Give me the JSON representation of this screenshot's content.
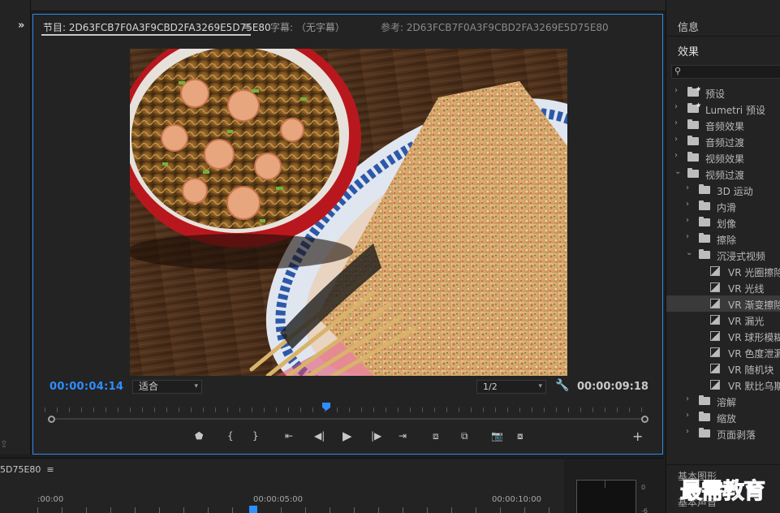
{
  "monitor": {
    "program_tab": "节目: 2D63FCB7F0A3F9CBD2FA3269E5D75E80",
    "menu_glyph": "≡",
    "caption_tab": "字幕: （无字幕）",
    "reference_tab": "参考: 2D63FCB7F0A3F9CBD2FA3269E5D75E80",
    "timecode_current": "00:00:04:14",
    "timecode_duration": "00:00:09:18",
    "fit_option": "适合",
    "resolution_option": "1/2",
    "playhead_fraction": 0.45
  },
  "right_panel": {
    "info_tab": "信息",
    "effects_tab": "效果",
    "tree": [
      {
        "label": "预设",
        "indent": 0,
        "expanded": false,
        "kind": "folder-star"
      },
      {
        "label": "Lumetri 预设",
        "indent": 0,
        "expanded": false,
        "kind": "folder-star"
      },
      {
        "label": "音频效果",
        "indent": 0,
        "expanded": false,
        "kind": "folder"
      },
      {
        "label": "音频过渡",
        "indent": 0,
        "expanded": false,
        "kind": "folder"
      },
      {
        "label": "视频效果",
        "indent": 0,
        "expanded": false,
        "kind": "folder"
      },
      {
        "label": "视频过渡",
        "indent": 0,
        "expanded": true,
        "kind": "folder"
      },
      {
        "label": "3D 运动",
        "indent": 1,
        "expanded": false,
        "kind": "folder"
      },
      {
        "label": "内滑",
        "indent": 1,
        "expanded": false,
        "kind": "folder"
      },
      {
        "label": "划像",
        "indent": 1,
        "expanded": false,
        "kind": "folder"
      },
      {
        "label": "擦除",
        "indent": 1,
        "expanded": false,
        "kind": "folder"
      },
      {
        "label": "沉浸式视频",
        "indent": 1,
        "expanded": true,
        "kind": "folder"
      },
      {
        "label": "VR 光圈擦除",
        "indent": 2,
        "kind": "effect"
      },
      {
        "label": "VR 光线",
        "indent": 2,
        "kind": "effect"
      },
      {
        "label": "VR 渐变擦除",
        "indent": 2,
        "kind": "effect",
        "selected": true
      },
      {
        "label": "VR 漏光",
        "indent": 2,
        "kind": "effect"
      },
      {
        "label": "VR 球形模糊",
        "indent": 2,
        "kind": "effect"
      },
      {
        "label": "VR 色度泄漏",
        "indent": 2,
        "kind": "effect"
      },
      {
        "label": "VR 随机块",
        "indent": 2,
        "kind": "effect"
      },
      {
        "label": "VR 默比乌斯",
        "indent": 2,
        "kind": "effect"
      },
      {
        "label": "溶解",
        "indent": 1,
        "expanded": false,
        "kind": "folder"
      },
      {
        "label": "缩放",
        "indent": 1,
        "expanded": false,
        "kind": "folder"
      },
      {
        "label": "页面剥落",
        "indent": 1,
        "expanded": false,
        "kind": "folder"
      }
    ],
    "basic_graphics": "基本图形",
    "basic_audio": "基本声音"
  },
  "timeline": {
    "title": "5D75E80",
    "menu_glyph": "≡",
    "tc_0": ":00:00",
    "tc_1": "00:00:05:00",
    "tc_2": "00:00:10:00"
  },
  "audio_meter": {
    "v0": "0",
    "v1": "-6"
  },
  "watermark": "最需教育",
  "colors": {
    "accent": "#2d8ceb",
    "timecode": "#2f8eff",
    "watermark": "#1f3fd0"
  }
}
